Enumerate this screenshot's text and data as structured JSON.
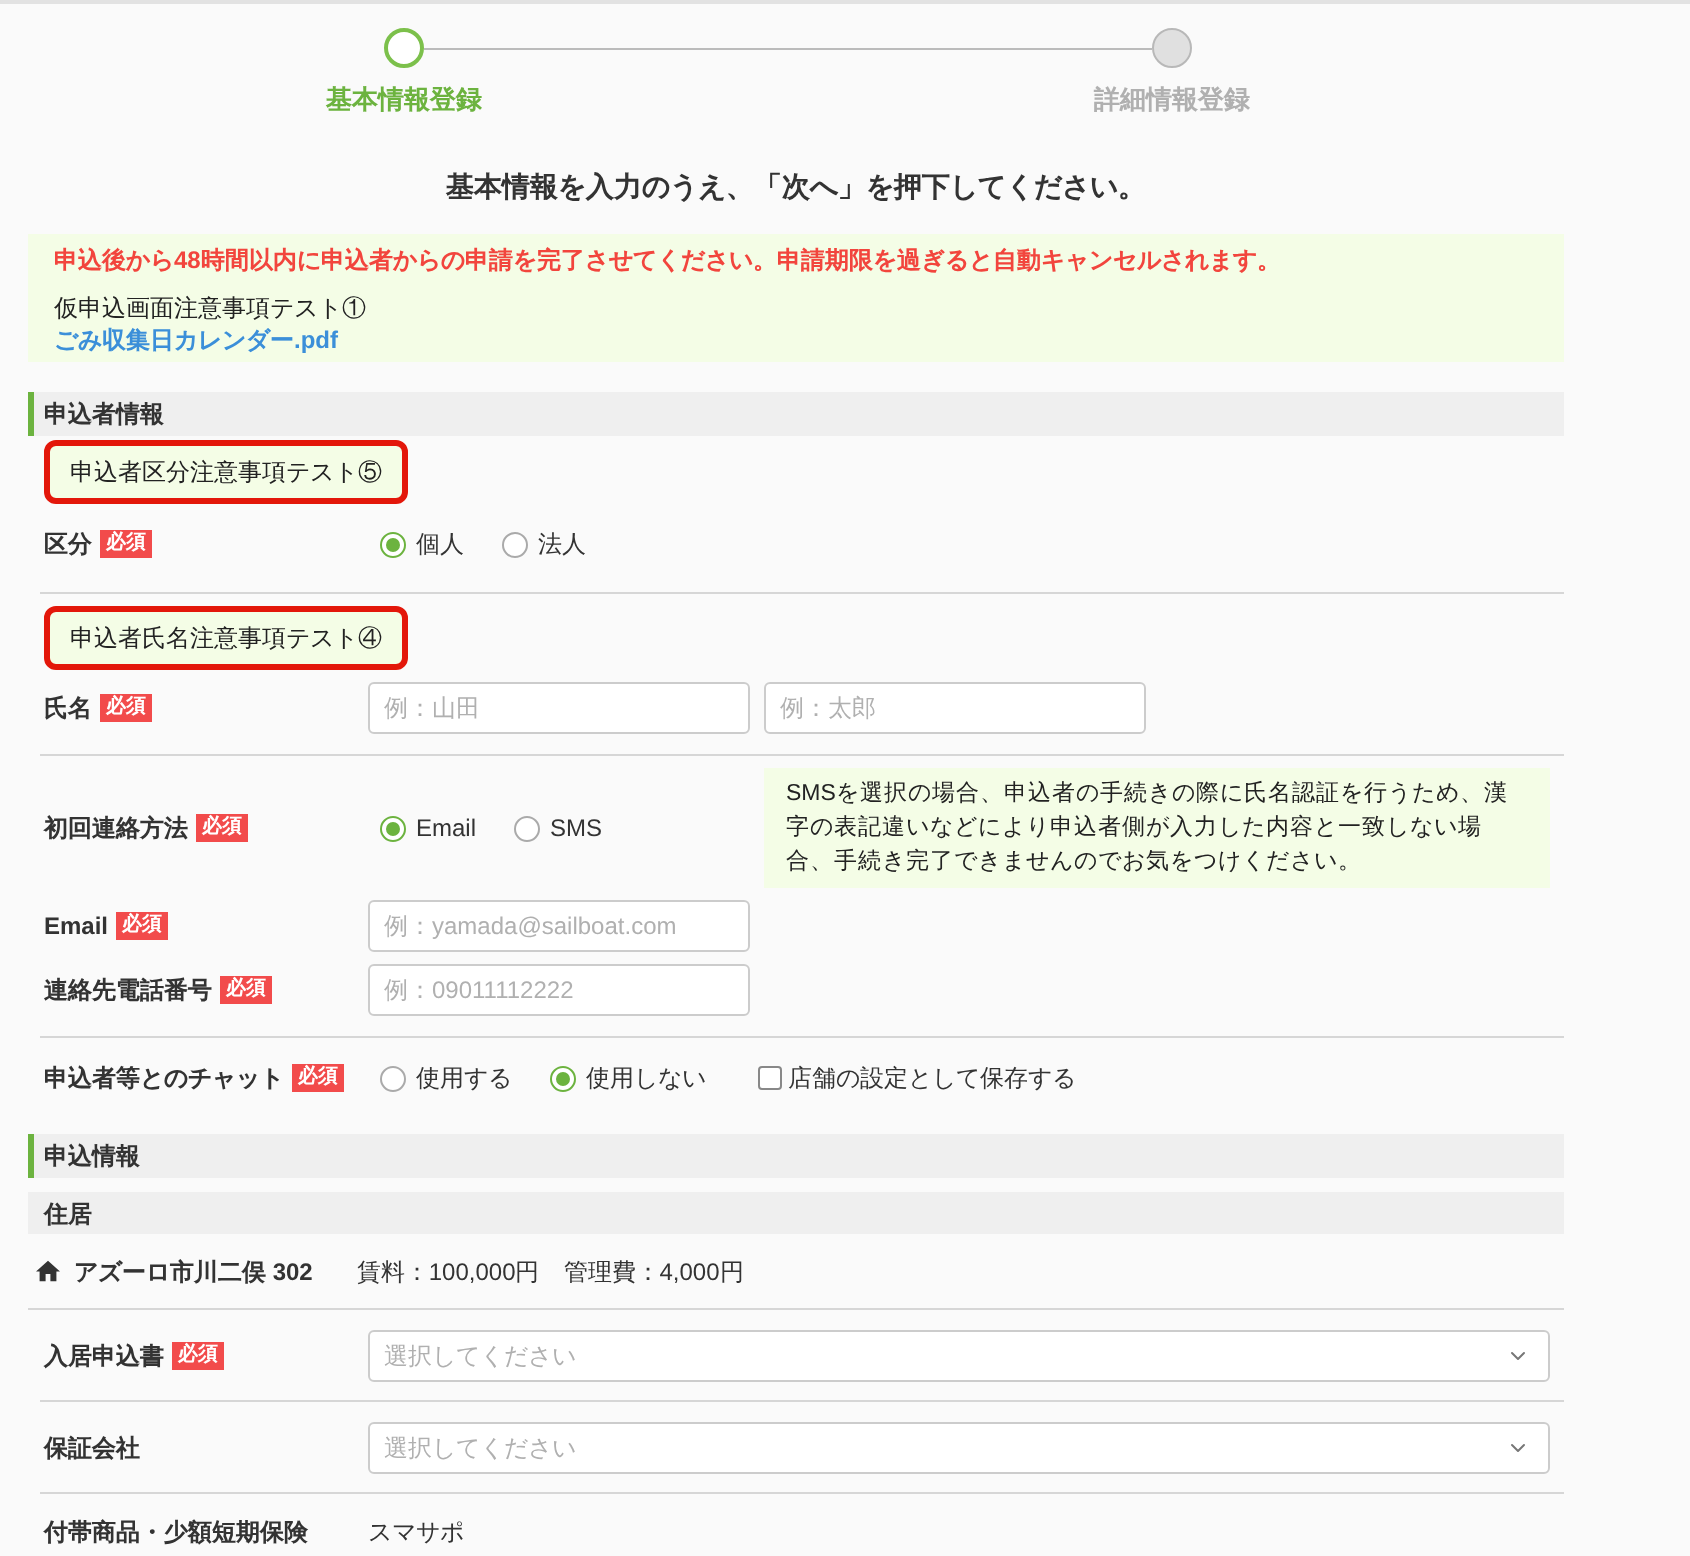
{
  "stepper": {
    "steps": [
      {
        "label": "基本情報登録",
        "selected": true
      },
      {
        "label": "詳細情報登録",
        "selected": false
      }
    ]
  },
  "instruction": "基本情報を入力のうえ、「次へ」を押下してください。",
  "notice": {
    "warning": "申込後から48時間以内に申込者からの申請を完了させてください。申請期限を過ぎると自動キャンセルされます。",
    "note": "仮申込画面注意事項テスト①",
    "attachment": "ごみ収集日カレンダー.pdf"
  },
  "applicant": {
    "title": "申込者情報",
    "groups": [
      {
        "rows": [
          {
            "kind": "note",
            "text": "申込者区分注意事項テスト⑤",
            "highlighted": true
          },
          {
            "kind": "radio",
            "label": "区分",
            "badge": "必須",
            "options": [
              {
                "label": "個人",
                "selected": true
              },
              {
                "label": "法人",
                "selected": false
              }
            ]
          }
        ]
      },
      {
        "rows": [
          {
            "kind": "note",
            "text": "申込者氏名注意事項テスト④",
            "highlighted": true
          },
          {
            "kind": "inputs",
            "label": "氏名",
            "badge": "必須",
            "fields": [
              {
                "placeholder": "例：山田"
              },
              {
                "placeholder": "例：太郎"
              }
            ]
          }
        ]
      },
      {
        "rows": [
          {
            "kind": "radio",
            "label": "初回連絡方法",
            "badge": "必須",
            "options": [
              {
                "label": "Email",
                "selected": true
              },
              {
                "label": "SMS",
                "selected": false
              }
            ],
            "info": "SMSを選択の場合、申込者の手続きの際に氏名認証を行うため、漢字の表記違いなどにより申込者側が入力した内容と一致しない場合、手続き完了できませんのでお気をつけください。"
          },
          {
            "kind": "inputs",
            "label": "Email",
            "badge": "必須",
            "fields": [
              {
                "placeholder": "例：yamada@sailboat.com"
              }
            ]
          },
          {
            "kind": "inputs",
            "label": "連絡先電話番号",
            "badge": "必須",
            "fields": [
              {
                "placeholder": "例：09011112222"
              }
            ]
          }
        ]
      },
      {
        "rows": [
          {
            "kind": "radio",
            "label": "申込者等とのチャット",
            "badge": "必須",
            "options": [
              {
                "label": "使用する",
                "selected": false
              },
              {
                "label": "使用しない",
                "selected": true
              }
            ],
            "checkbox": {
              "label": "店舗の設定として保存する",
              "checked": false
            }
          }
        ]
      }
    ]
  },
  "application": {
    "title": "申込情報",
    "subsection": "住居",
    "property": {
      "name": "アズーロ市川二俣 302",
      "rent": "賃料：100,000円",
      "fee": "管理費：4,000円"
    },
    "rows": [
      {
        "kind": "select",
        "label": "入居申込書",
        "badge": "必須",
        "placeholder": "選択してください"
      },
      {
        "kind": "select",
        "label": "保証会社",
        "placeholder": "選択してください"
      },
      {
        "kind": "text",
        "label": "付帯商品・少額短期保険",
        "value": "スマサポ"
      }
    ]
  }
}
